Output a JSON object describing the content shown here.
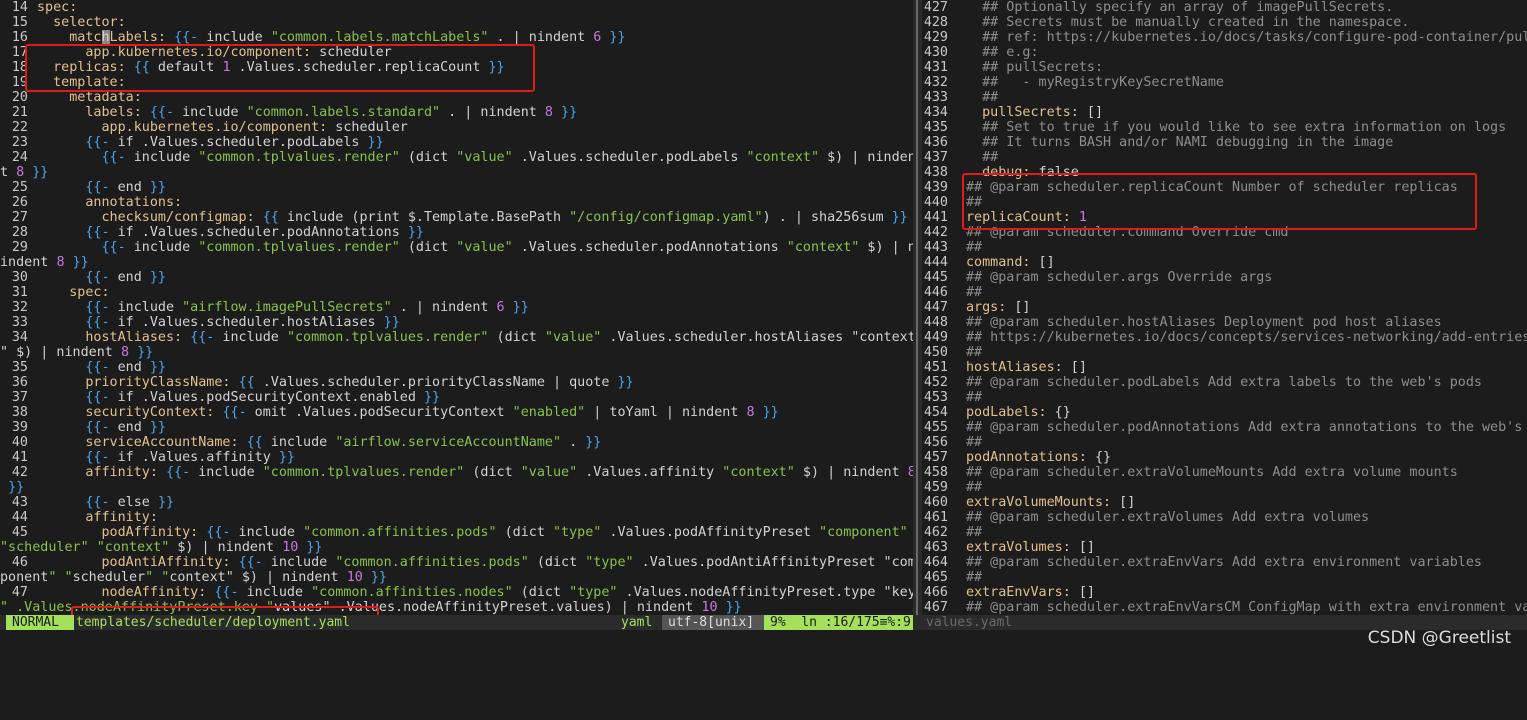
{
  "left_lines": [
    {
      "n": "14",
      "code": "spec:"
    },
    {
      "n": "15",
      "code": "  selector:"
    },
    {
      "n": "16",
      "code": "    matchLabels: {{- include \"common.labels.matchLabels\" . | nindent 6 }}"
    },
    {
      "n": "17",
      "code": "      app.kubernetes.io/component: scheduler"
    },
    {
      "n": "18",
      "code": "  replicas: {{ default 1 .Values.scheduler.replicaCount }}"
    },
    {
      "n": "19",
      "code": "  template:"
    },
    {
      "n": "20",
      "code": "    metadata:"
    },
    {
      "n": "21",
      "code": "      labels: {{- include \"common.labels.standard\" . | nindent 8 }}"
    },
    {
      "n": "22",
      "code": "        app.kubernetes.io/component: scheduler"
    },
    {
      "n": "23",
      "code": "      {{- if .Values.scheduler.podLabels }}"
    },
    {
      "n": "24",
      "code": "        {{- include \"common.tplvalues.render\" (dict \"value\" .Values.scheduler.podLabels \"context\" $) | ninden"
    },
    {
      "n": "",
      "code": "t 8 }}",
      "wrap": true
    },
    {
      "n": "25",
      "code": "      {{- end }}"
    },
    {
      "n": "26",
      "code": "      annotations:"
    },
    {
      "n": "27",
      "code": "        checksum/configmap: {{ include (print $.Template.BasePath \"/config/configmap.yaml\") . | sha256sum }}"
    },
    {
      "n": "28",
      "code": "      {{- if .Values.scheduler.podAnnotations }}"
    },
    {
      "n": "29",
      "code": "        {{- include \"common.tplvalues.render\" (dict \"value\" .Values.scheduler.podAnnotations \"context\" $) | n"
    },
    {
      "n": "",
      "code": "indent 8 }}",
      "wrap": true
    },
    {
      "n": "30",
      "code": "      {{- end }}"
    },
    {
      "n": "31",
      "code": "    spec:"
    },
    {
      "n": "32",
      "code": "      {{- include \"airflow.imagePullSecrets\" . | nindent 6 }}"
    },
    {
      "n": "33",
      "code": "      {{- if .Values.scheduler.hostAliases }}"
    },
    {
      "n": "34",
      "code": "      hostAliases: {{- include \"common.tplvalues.render\" (dict \"value\" .Values.scheduler.hostAliases \"context"
    },
    {
      "n": "",
      "code": "\" $) | nindent 8 }}",
      "wrap": true
    },
    {
      "n": "35",
      "code": "      {{- end }}"
    },
    {
      "n": "36",
      "code": "      priorityClassName: {{ .Values.scheduler.priorityClassName | quote }}"
    },
    {
      "n": "37",
      "code": "      {{- if .Values.podSecurityContext.enabled }}"
    },
    {
      "n": "38",
      "code": "      securityContext: {{- omit .Values.podSecurityContext \"enabled\" | toYaml | nindent 8 }}"
    },
    {
      "n": "39",
      "code": "      {{- end }}"
    },
    {
      "n": "40",
      "code": "      serviceAccountName: {{ include \"airflow.serviceAccountName\" . }}"
    },
    {
      "n": "41",
      "code": "      {{- if .Values.affinity }}"
    },
    {
      "n": "42",
      "code": "      affinity: {{- include \"common.tplvalues.render\" (dict \"value\" .Values.affinity \"context\" $) | nindent 8"
    },
    {
      "n": "",
      "code": " }}",
      "wrap": true
    },
    {
      "n": "43",
      "code": "      {{- else }}"
    },
    {
      "n": "44",
      "code": "      affinity:"
    },
    {
      "n": "45",
      "code": "        podAffinity: {{- include \"common.affinities.pods\" (dict \"type\" .Values.podAffinityPreset \"component\""
    },
    {
      "n": "",
      "code": "\"scheduler\" \"context\" $) | nindent 10 }}",
      "wrap": true
    },
    {
      "n": "46",
      "code": "        podAntiAffinity: {{- include \"common.affinities.pods\" (dict \"type\" .Values.podAntiAffinityPreset \"com"
    },
    {
      "n": "",
      "code": "ponent\" \"scheduler\" \"context\" $) | nindent 10 }}",
      "wrap": true
    },
    {
      "n": "47",
      "code": "        nodeAffinity: {{- include \"common.affinities.nodes\" (dict \"type\" .Values.nodeAffinityPreset.type \"key"
    },
    {
      "n": "",
      "code": "\" .Values.nodeAffinityPreset.key \"values\" .Values.nodeAffinityPreset.values) | nindent 10 }}",
      "wrap": true
    }
  ],
  "right_lines": [
    {
      "n": "427",
      "code": "  ## Optionally specify an array of imagePullSecrets."
    },
    {
      "n": "428",
      "code": "  ## Secrets must be manually created in the namespace."
    },
    {
      "n": "429",
      "code": "  ## ref: https://kubernetes.io/docs/tasks/configure-pod-container/pul"
    },
    {
      "n": "430",
      "code": "  ## e.g:"
    },
    {
      "n": "431",
      "code": "  ## pullSecrets:"
    },
    {
      "n": "432",
      "code": "  ##   - myRegistryKeySecretName"
    },
    {
      "n": "433",
      "code": "  ##"
    },
    {
      "n": "434",
      "code": "  pullSecrets: []"
    },
    {
      "n": "435",
      "code": "  ## Set to true if you would like to see extra information on logs"
    },
    {
      "n": "436",
      "code": "  ## It turns BASH and/or NAMI debugging in the image"
    },
    {
      "n": "437",
      "code": "  ##"
    },
    {
      "n": "438",
      "code": "  debug: false"
    },
    {
      "n": "439",
      "code": "## @param scheduler.replicaCount Number of scheduler replicas"
    },
    {
      "n": "440",
      "code": "##"
    },
    {
      "n": "441",
      "code": "replicaCount: 1"
    },
    {
      "n": "442",
      "code": "## @param scheduler.command Override cmd"
    },
    {
      "n": "443",
      "code": "##"
    },
    {
      "n": "444",
      "code": "command: []"
    },
    {
      "n": "445",
      "code": "## @param scheduler.args Override args"
    },
    {
      "n": "446",
      "code": "##"
    },
    {
      "n": "447",
      "code": "args: []"
    },
    {
      "n": "448",
      "code": "## @param scheduler.hostAliases Deployment pod host aliases"
    },
    {
      "n": "449",
      "code": "## https://kubernetes.io/docs/concepts/services-networking/add-entries"
    },
    {
      "n": "450",
      "code": "##"
    },
    {
      "n": "451",
      "code": "hostAliases: []"
    },
    {
      "n": "452",
      "code": "## @param scheduler.podLabels Add extra labels to the web's pods"
    },
    {
      "n": "453",
      "code": "##"
    },
    {
      "n": "454",
      "code": "podLabels: {}"
    },
    {
      "n": "455",
      "code": "## @param scheduler.podAnnotations Add extra annotations to the web's"
    },
    {
      "n": "456",
      "code": "##"
    },
    {
      "n": "457",
      "code": "podAnnotations: {}"
    },
    {
      "n": "458",
      "code": "## @param scheduler.extraVolumeMounts Add extra volume mounts"
    },
    {
      "n": "459",
      "code": "##"
    },
    {
      "n": "460",
      "code": "extraVolumeMounts: []"
    },
    {
      "n": "461",
      "code": "## @param scheduler.extraVolumes Add extra volumes"
    },
    {
      "n": "462",
      "code": "##"
    },
    {
      "n": "463",
      "code": "extraVolumes: []"
    },
    {
      "n": "464",
      "code": "## @param scheduler.extraEnvVars Add extra environment variables"
    },
    {
      "n": "465",
      "code": "##"
    },
    {
      "n": "466",
      "code": "extraEnvVars: []"
    },
    {
      "n": "467",
      "code": "## @param scheduler.extraEnvVarsCM ConfigMap with extra environment va"
    }
  ],
  "status": {
    "mode": "NORMAL",
    "filename": "templates/scheduler/deployment.yaml",
    "filetype": "yaml",
    "encoding": "utf-8[unix]",
    "position": "9%  ln :16/175≡%:9",
    "right_filename": "values.yaml"
  },
  "watermark": "CSDN @Greetlist",
  "colors": {
    "background": "#1c1c1c",
    "key": "#e2c08d",
    "brace": "#4ba3e8",
    "string": "#88c24a",
    "number": "#c678dd",
    "comment": "#8e8e8e",
    "status_accent": "#a5e05b",
    "highlight": "#e01b1b"
  }
}
